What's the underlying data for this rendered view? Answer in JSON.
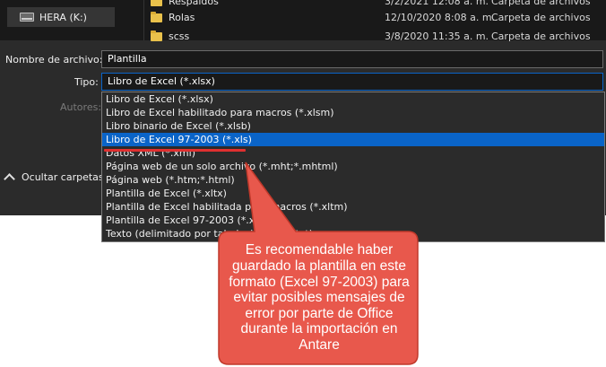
{
  "nav": {
    "drive_label": "HERA (K:)"
  },
  "files": [
    {
      "name": "Respaldos",
      "date": "3/2/2021 12:08 a. m.",
      "type": "Carpeta de archivos"
    },
    {
      "name": "Rolas",
      "date": "12/10/2020 8:08 a. m.",
      "type": "Carpeta de archivos"
    },
    {
      "name": "scss",
      "date": "3/8/2020 11:35 a. m.",
      "type": "Carpeta de archivos"
    }
  ],
  "form": {
    "filename_label": "Nombre de archivo:",
    "filename_value": "Plantilla",
    "type_label": "Tipo:",
    "type_value": "Libro de Excel (*.xlsx)",
    "authors_label": "Autores:"
  },
  "hide_folders_label": "Ocultar carpetas",
  "type_options": [
    "Libro de Excel (*.xlsx)",
    "Libro de Excel habilitado para macros (*.xlsm)",
    "Libro binario de Excel (*.xlsb)",
    "Libro de Excel 97-2003 (*.xls)",
    "Datos XML (*.xml)",
    "Página web de un solo archivo (*.mht;*.mhtml)",
    "Página web (*.htm;*.html)",
    "Plantilla de Excel (*.xltx)",
    "Plantilla de Excel habilitada para macros (*.xltm)",
    "Plantilla de Excel 97-2003 (*.xlt)",
    "Texto (delimitado por tabulaciones) (*.txt)"
  ],
  "selected_option": "Libro de Excel 97-2003 (*.xls)",
  "callout": {
    "text": "Es recomendable haber guardado la plantilla en este formato (Excel 97-2003) para evitar posibles mensajes de error por parte de Office durante la importación en Antare"
  },
  "colors": {
    "dialog_bg": "#2b2b2b",
    "selection": "#0a64c8",
    "callout_fill": "#e8584c",
    "callout_border": "#c0392b",
    "highlight_underline": "#e03030"
  }
}
